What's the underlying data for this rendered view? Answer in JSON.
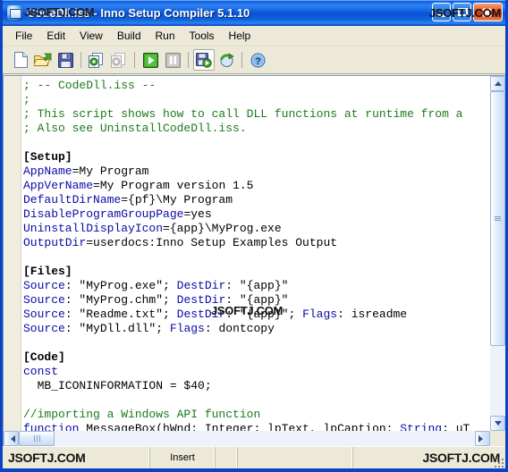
{
  "window": {
    "title": "CodeDll.iss - Inno Setup Compiler 5.1.10",
    "icon_name": "inno-setup-icon",
    "watermark": "JSOFTJ.COM",
    "caption_watermark": "JSOFTJ.COM",
    "colors": {
      "title_gradient_start": "#0a56d6",
      "title_gradient_end": "#0c51c8",
      "face": "#ece9d8",
      "close_button": "#c9310a",
      "editor_bg": "#ffffff",
      "gutter": "#f0ece0",
      "comment": "#1b7a1b",
      "keyword": "#0a0aa8",
      "plain": "#000000"
    },
    "buttons": [
      {
        "name": "minimize-button",
        "label": "Minimize"
      },
      {
        "name": "maximize-button",
        "label": "Maximize"
      },
      {
        "name": "close-button",
        "label": "Close"
      }
    ]
  },
  "menubar": {
    "items": [
      {
        "label": "File"
      },
      {
        "label": "Edit"
      },
      {
        "label": "View"
      },
      {
        "label": "Build"
      },
      {
        "label": "Run"
      },
      {
        "label": "Tools"
      },
      {
        "label": "Help"
      }
    ]
  },
  "toolbar": {
    "buttons": [
      {
        "name": "new-file-button",
        "icon": "new-document-icon",
        "label": "New"
      },
      {
        "name": "open-file-button",
        "icon": "open-folder-icon",
        "label": "Open"
      },
      {
        "name": "save-file-button",
        "icon": "floppy-disk-icon",
        "label": "Save"
      },
      {
        "name": "print-button",
        "icon": "print-icon",
        "label": "Print"
      },
      {
        "name": "print-preview-button",
        "icon": "print-preview-icon",
        "label": "Print Preview"
      },
      {
        "name": "run-button",
        "icon": "green-play-icon",
        "label": "Run"
      },
      {
        "name": "pause-button",
        "icon": "pause-icon",
        "label": "Pause"
      },
      {
        "name": "compile-button",
        "icon": "compile-setup-icon",
        "label": "Compile"
      },
      {
        "name": "refresh-button",
        "icon": "refresh-globe-icon",
        "label": "Refresh"
      },
      {
        "name": "help-button",
        "icon": "help-question-icon",
        "label": "Help"
      }
    ]
  },
  "editor": {
    "watermark": "JSOFTJ.COM",
    "lines": [
      {
        "segments": [
          {
            "t": "; -- CodeDll.iss --",
            "c": "cm"
          }
        ]
      },
      {
        "segments": [
          {
            "t": ";",
            "c": "cm"
          }
        ]
      },
      {
        "segments": [
          {
            "t": "; This script shows how to call DLL functions at runtime from a",
            "c": "cm"
          }
        ]
      },
      {
        "segments": [
          {
            "t": "; Also see UninstallCodeDll.iss.",
            "c": "cm"
          }
        ]
      },
      {
        "segments": []
      },
      {
        "segments": [
          {
            "t": "[Setup]",
            "c": "sec"
          }
        ]
      },
      {
        "segments": [
          {
            "t": "AppName",
            "c": "kw"
          },
          {
            "t": "=My Program",
            "c": "pl"
          }
        ]
      },
      {
        "segments": [
          {
            "t": "AppVerName",
            "c": "kw"
          },
          {
            "t": "=My Program version 1.5",
            "c": "pl"
          }
        ]
      },
      {
        "segments": [
          {
            "t": "DefaultDirName",
            "c": "kw"
          },
          {
            "t": "={pf}\\My Program",
            "c": "pl"
          }
        ]
      },
      {
        "segments": [
          {
            "t": "DisableProgramGroupPage",
            "c": "kw"
          },
          {
            "t": "=yes",
            "c": "pl"
          }
        ]
      },
      {
        "segments": [
          {
            "t": "UninstallDisplayIcon",
            "c": "kw"
          },
          {
            "t": "={app}\\MyProg.exe",
            "c": "pl"
          }
        ]
      },
      {
        "segments": [
          {
            "t": "OutputDir",
            "c": "kw"
          },
          {
            "t": "=userdocs:Inno Setup Examples Output",
            "c": "pl"
          }
        ]
      },
      {
        "segments": []
      },
      {
        "segments": [
          {
            "t": "[Files]",
            "c": "sec"
          }
        ]
      },
      {
        "segments": [
          {
            "t": "Source",
            "c": "kw"
          },
          {
            "t": ": \"MyProg.exe\"; ",
            "c": "pl"
          },
          {
            "t": "DestDir",
            "c": "kw"
          },
          {
            "t": ": \"{app}\"",
            "c": "pl"
          }
        ]
      },
      {
        "segments": [
          {
            "t": "Source",
            "c": "kw"
          },
          {
            "t": ": \"MyProg.chm\"; ",
            "c": "pl"
          },
          {
            "t": "DestDir",
            "c": "kw"
          },
          {
            "t": ": \"{app}\"",
            "c": "pl"
          }
        ]
      },
      {
        "segments": [
          {
            "t": "Source",
            "c": "kw"
          },
          {
            "t": ": \"Readme.txt\"; ",
            "c": "pl"
          },
          {
            "t": "DestDir",
            "c": "kw"
          },
          {
            "t": ": \"{app}\"; ",
            "c": "pl"
          },
          {
            "t": "Flags",
            "c": "kw"
          },
          {
            "t": ": isreadme",
            "c": "pl"
          }
        ]
      },
      {
        "segments": [
          {
            "t": "Source",
            "c": "kw"
          },
          {
            "t": ": \"MyDll.dll\"; ",
            "c": "pl"
          },
          {
            "t": "Flags",
            "c": "kw"
          },
          {
            "t": ": dontcopy",
            "c": "pl"
          }
        ]
      },
      {
        "segments": []
      },
      {
        "segments": [
          {
            "t": "[Code]",
            "c": "sec"
          }
        ]
      },
      {
        "segments": [
          {
            "t": "const",
            "c": "kw"
          }
        ]
      },
      {
        "segments": [
          {
            "t": "  MB_ICONINFORMATION = $40;",
            "c": "pl"
          }
        ]
      },
      {
        "segments": []
      },
      {
        "segments": [
          {
            "t": "//importing a Windows API function",
            "c": "cm"
          }
        ]
      },
      {
        "segments": [
          {
            "t": "function",
            "c": "kw"
          },
          {
            "t": " MessageBox(hWnd: Integer; lpText, lpCaption: ",
            "c": "pl"
          },
          {
            "t": "String",
            "c": "kw"
          },
          {
            "t": "; uT",
            "c": "pl"
          }
        ]
      }
    ]
  },
  "scrollbars": {
    "vertical": {
      "up_label": "Scroll up",
      "down_label": "Scroll down"
    },
    "horizontal": {
      "left_label": "Scroll left",
      "right_label": "Scroll right"
    }
  },
  "statusbar": {
    "panels": [
      {
        "name": "status-panel-position",
        "text": ""
      },
      {
        "name": "status-panel-insert-mode",
        "text": "Insert"
      },
      {
        "name": "status-panel-modified",
        "text": ""
      },
      {
        "name": "status-panel-filename",
        "text": ""
      },
      {
        "name": "status-panel-message",
        "text": ""
      }
    ],
    "watermark_left": "JSOFTJ.COM",
    "watermark_right": "JSOFTJ.COM"
  }
}
